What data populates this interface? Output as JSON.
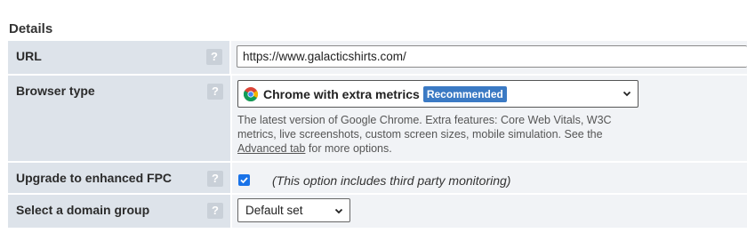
{
  "section": {
    "title": "Details"
  },
  "rows": {
    "url": {
      "label": "URL",
      "help": "?",
      "value": "https://www.galacticshirts.com/"
    },
    "browser": {
      "label": "Browser type",
      "help": "?",
      "selected": "Chrome with extra metrics",
      "badge": "Recommended",
      "icon": "chrome-icon",
      "desc_text": "The latest version of Google Chrome. Extra features: Core Web Vitals, W3C metrics, live screenshots, custom screen sizes, mobile simulation. See the ",
      "desc_link": "Advanced tab",
      "desc_suffix": " for more options."
    },
    "fpc": {
      "label": "Upgrade to enhanced FPC",
      "help": "?",
      "checked": true,
      "note": "(This option includes third party monitoring)"
    },
    "domain": {
      "label": "Select a domain group",
      "help": "?",
      "selected": "Default set"
    }
  },
  "colors": {
    "label_bg": "#dde3ea",
    "value_bg": "#f1f3f6",
    "badge_bg": "#3b7ac4",
    "checkbox": "#1a73e8"
  }
}
